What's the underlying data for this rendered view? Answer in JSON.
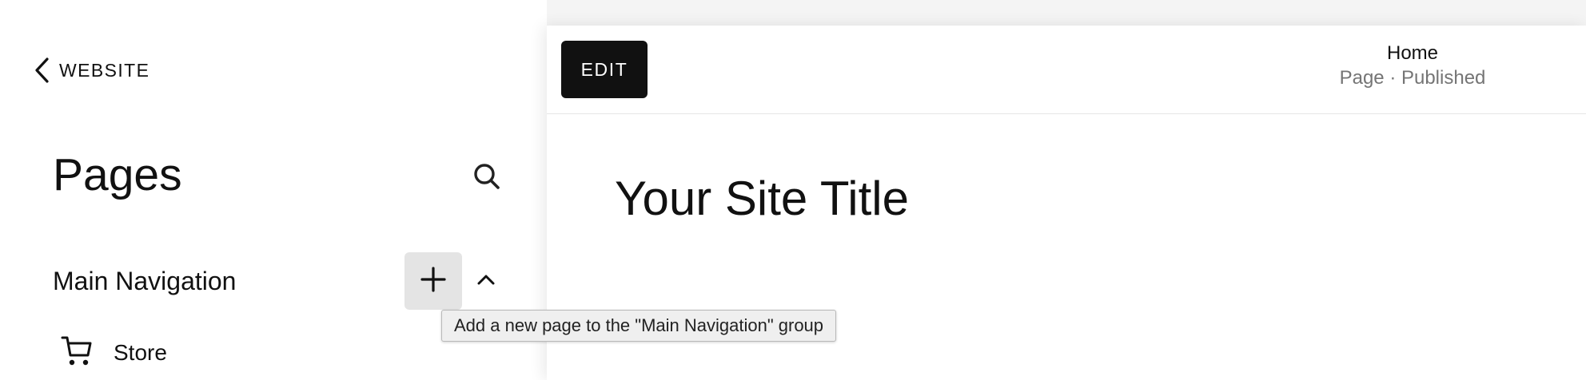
{
  "sidebar": {
    "back_label": "WEBSITE",
    "title": "Pages",
    "nav_group": {
      "title": "Main Navigation",
      "add_tooltip": "Add a new page to the \"Main Navigation\" group",
      "items": [
        {
          "label": "Store",
          "icon": "cart-icon"
        }
      ]
    }
  },
  "preview": {
    "edit_label": "EDIT",
    "page_title": "Home",
    "page_status": "Page · Published",
    "site_title": "Your Site Title"
  },
  "colors": {
    "edit_button_bg": "#111111",
    "add_button_bg": "#e4e4e4",
    "status_text": "#757575"
  }
}
